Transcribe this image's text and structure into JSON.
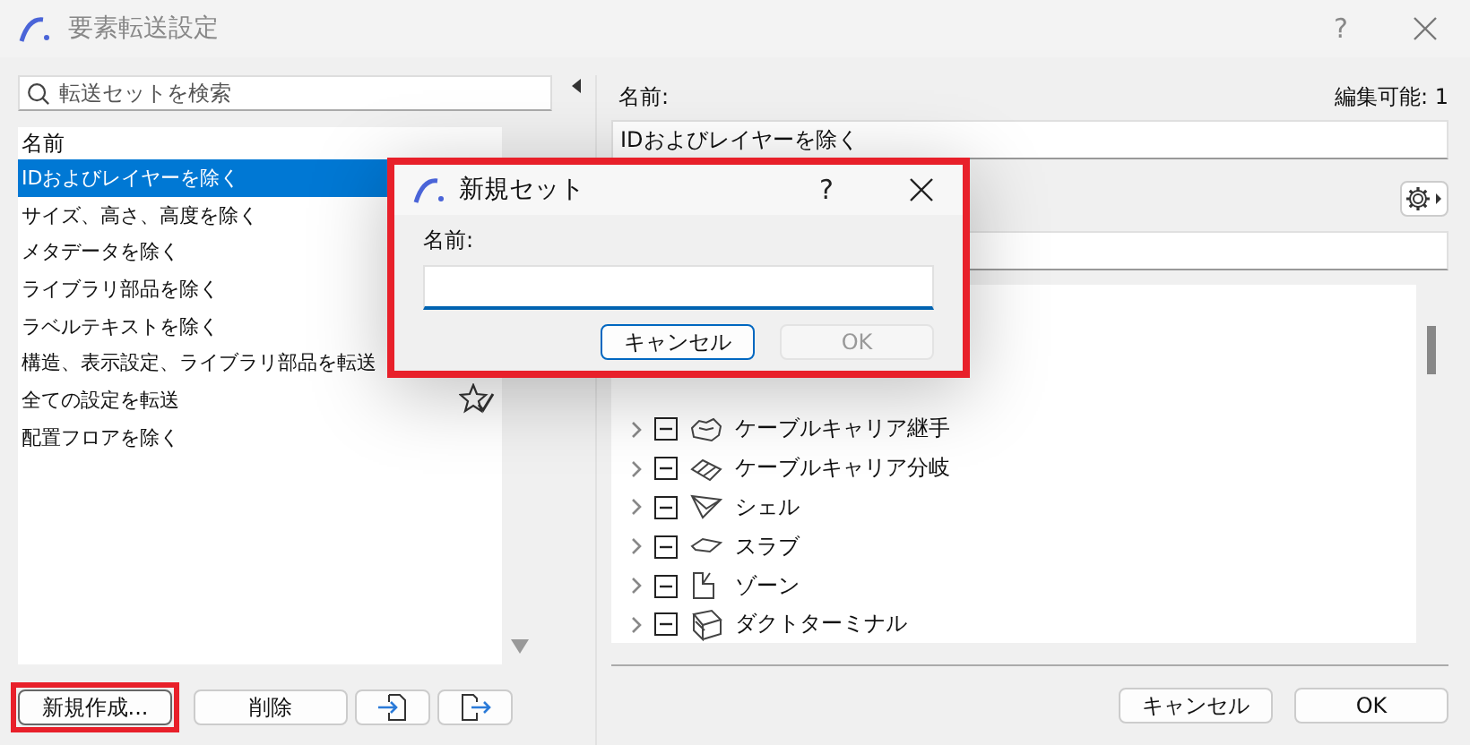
{
  "window": {
    "title": "要素転送設定",
    "help": "?"
  },
  "search": {
    "placeholder": "転送セットを検索"
  },
  "set_list": {
    "column": "名前",
    "items": [
      {
        "label": "IDおよびレイヤーを除く",
        "selected": true,
        "starred": false
      },
      {
        "label": "サイズ、高さ、高度を除く",
        "selected": false,
        "starred": false
      },
      {
        "label": "メタデータを除く",
        "selected": false,
        "starred": false
      },
      {
        "label": "ライブラリ部品を除く",
        "selected": false,
        "starred": false
      },
      {
        "label": "ラベルテキストを除く",
        "selected": false,
        "starred": false
      },
      {
        "label": "構造、表示設定、ライブラリ部品を転送",
        "selected": false,
        "starred": false
      },
      {
        "label": "全ての設定を転送",
        "selected": false,
        "starred": true
      },
      {
        "label": "配置フロアを除く",
        "selected": false,
        "starred": false
      }
    ]
  },
  "left_buttons": {
    "new": "新規作成...",
    "delete": "削除"
  },
  "details": {
    "name_label": "名前:",
    "editable": "編集可能: 1",
    "name_value": "IDおよびレイヤーを除く"
  },
  "tree": [
    {
      "label": "ケーブルキャリア継手",
      "expanded": false,
      "partial": true
    },
    {
      "label": "ケーブルキャリア分岐",
      "expanded": false,
      "partial": true
    },
    {
      "label": "シェル",
      "expanded": false,
      "partial": true
    },
    {
      "label": "スラブ",
      "expanded": false,
      "partial": true
    },
    {
      "label": "ゾーン",
      "expanded": false,
      "partial": true
    },
    {
      "label": "ダクトターミナル",
      "expanded": false,
      "partial": true
    }
  ],
  "buttons": [
    "キャンセル",
    "OK"
  ],
  "dialog": {
    "title": "新規セット",
    "help": "?",
    "name_label": "名前:",
    "buttons": [
      {
        "label": "キャンセル",
        "disabled": false
      },
      {
        "label": "OK",
        "disabled": true
      }
    ]
  }
}
